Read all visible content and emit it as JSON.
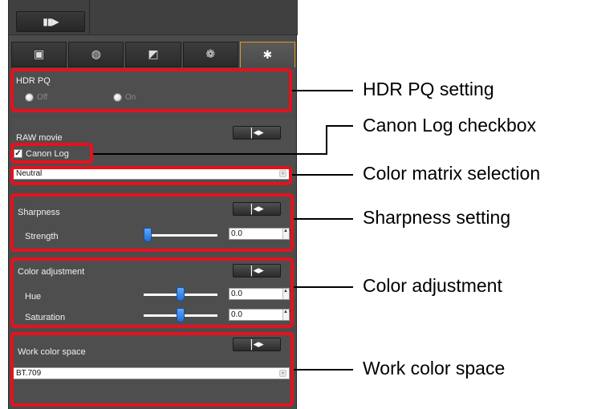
{
  "toolbar": {
    "viewer_icon": "viewer-toggle-icon",
    "viewer_glyph": "▮▮▶"
  },
  "tabs": [
    {
      "icon": "image-adjust-icon",
      "glyph": "▣"
    },
    {
      "icon": "nr-magnify-icon",
      "glyph": "◍"
    },
    {
      "icon": "tone-curve-icon",
      "glyph": "◩"
    },
    {
      "icon": "color-wheel-icon",
      "glyph": "❁"
    },
    {
      "icon": "gear-icon",
      "glyph": "✱"
    }
  ],
  "hdr_pq": {
    "title": "HDR PQ",
    "options": [
      {
        "label": "Off",
        "selected": true
      },
      {
        "label": "On",
        "selected": false
      }
    ]
  },
  "raw_movie": {
    "title": "RAW movie",
    "reset_glyph": "|◂▸",
    "canon_log_label": "Canon Log",
    "canon_log_checked": true,
    "check_glyph": "✓",
    "color_matrix_value": "Neutral",
    "select_arrow_glyph": "▾"
  },
  "sharpness": {
    "title": "Sharpness",
    "reset_glyph": "|◂▸",
    "strength_label": "Strength",
    "strength_value": "0.0",
    "strength_level": 0.0,
    "spin_glyph": "▲▼"
  },
  "color_adjustment": {
    "title": "Color adjustment",
    "reset_glyph": "|◂▸",
    "hue_label": "Hue",
    "hue_value": "0.0",
    "hue_level": 0.5,
    "saturation_label": "Saturation",
    "saturation_value": "0.0",
    "saturation_level": 0.5,
    "spin_glyph": "▲▼"
  },
  "work_color_space": {
    "title": "Work color space",
    "reset_glyph": "|◂▸",
    "value": "BT.709",
    "select_arrow_glyph": "▾"
  },
  "callouts": [
    "HDR PQ setting",
    "Canon Log checkbox",
    "Color matrix selection",
    "Sharpness setting",
    "Color adjustment",
    "Work color space"
  ],
  "colors": {
    "highlight": "#e8101e",
    "panel": "#4b4b4b",
    "slider_thumb": "#2f86ef",
    "active_tab_border": "#d89a2a"
  }
}
